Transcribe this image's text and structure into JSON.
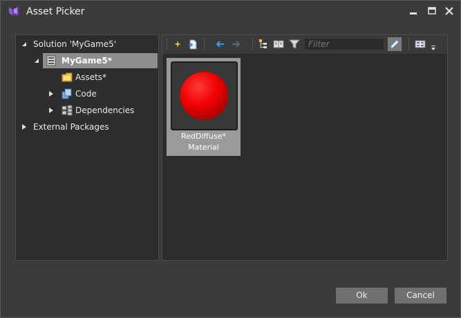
{
  "window": {
    "title": "Asset Picker"
  },
  "tree": {
    "items": [
      {
        "label": "Solution 'MyGame5'"
      },
      {
        "label": "MyGame5*"
      },
      {
        "label": "Assets*"
      },
      {
        "label": "Code"
      },
      {
        "label": "Dependencies"
      },
      {
        "label": "External Packages"
      }
    ]
  },
  "toolbar": {
    "filter_placeholder": "Filter"
  },
  "assets": [
    {
      "name": "RedDiffuse*",
      "type": "Material",
      "thumbnail_color": "#ff0000"
    }
  ],
  "buttons": {
    "ok": "Ok",
    "cancel": "Cancel"
  },
  "colors": {
    "accent_selected": "#8d8d8d",
    "material": "#ff0000",
    "folder": "#f0c040"
  }
}
